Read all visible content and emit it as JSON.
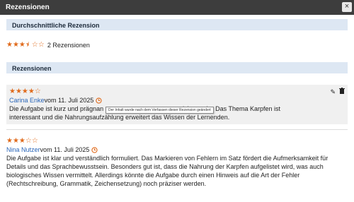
{
  "window": {
    "title": "Rezensionen",
    "close_label": "×"
  },
  "average": {
    "heading": "Durchschnittliche Rezension",
    "stars_full": "★★★",
    "stars_half": "★",
    "stars_empty": "☆☆",
    "rating": 3.5,
    "count_text": "2 Rezensionen"
  },
  "reviews_section": {
    "heading": "Rezensionen"
  },
  "reviews": [
    {
      "stars_full": "★★★★",
      "stars_empty": "☆",
      "rating": 4,
      "author": "Carina Enke",
      "date_text": " vom 11. Juli 2025",
      "text_line1_a": "Die Aufgabe ist kurz und prägnan",
      "text_line1_b": "rricht macht. Das Thema Karpfen ist",
      "text_line2_a": "interessant und die Nahrungsauf",
      "text_line2_b": "zählung erweitert das Wissen der Lernenden.",
      "tooltip": "Der Inhalt wurde nach dem Verfassen dieser Rezension geändert",
      "edit_icon": "✎",
      "delete_icon": "🗑"
    },
    {
      "stars_full": "★★★",
      "stars_empty": "☆☆",
      "rating": 3,
      "author": "Nina Nutzer",
      "date_text": " vom 11. Juli 2025",
      "lines": [
        "Die Aufgabe ist klar und verständlich formuliert. Das Markieren von Fehlern im Satz fördert die Aufmerksamkeit für",
        "Details und das Sprachbewusstsein. Besonders gut ist, dass die Nahrung der Karpfen aufgelistet wird, was auch",
        "biologisches Wissen vermittelt. Allerdings könnte die Aufgabe durch einen Hinweis auf die Art der Fehler",
        "(Rechtschreibung, Grammatik, Zeichensetzung) noch präziser werden."
      ]
    }
  ],
  "colors": {
    "accent": "#e06a1b",
    "link": "#2a66b8",
    "section_bg": "#dde7f3",
    "titlebar": "#3d3d3d"
  }
}
